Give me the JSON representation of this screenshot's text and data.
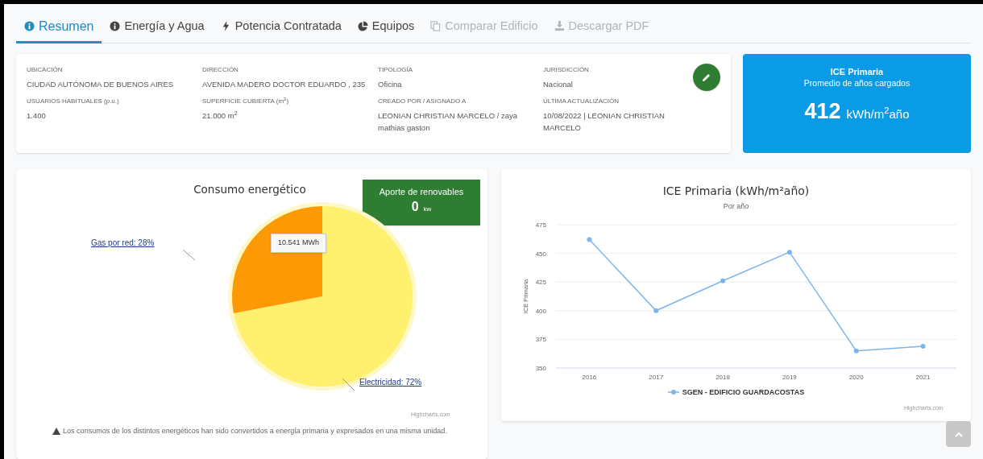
{
  "tabs": [
    {
      "label": "Resumen",
      "selected": true,
      "disabled": false
    },
    {
      "label": "Energía y Agua",
      "selected": false,
      "disabled": false
    },
    {
      "label": "Potencia Contratada",
      "selected": false,
      "disabled": false
    },
    {
      "label": "Equipos",
      "selected": false,
      "disabled": false
    },
    {
      "label": "Comparar Edificio",
      "selected": false,
      "disabled": true
    },
    {
      "label": "Descargar PDF",
      "selected": false,
      "disabled": true
    }
  ],
  "info_fields": [
    {
      "label": "UBICACIÓN",
      "value": "CIUDAD AUTÓNOMA DE BUENOS AIRES"
    },
    {
      "label": "DIRECCIÓN",
      "value": "AVENIDA MADERO DOCTOR EDUARDO , 235"
    },
    {
      "label": "TIPOLOGÍA",
      "value": "Oficina"
    },
    {
      "label": "JURISDICCIÓN",
      "value": "Nacional"
    },
    {
      "label": "USUARIOS HABITUALES (p.u.)",
      "value": "1.400"
    },
    {
      "label": "SUPERFICIE CUBIERTA (m$^{2}$)",
      "value": "21.000 m$^{2}$"
    },
    {
      "label": "CREADO POR / ASIGNADO A",
      "value": "LEONIAN CHRISTIAN MARCELO / zaya mathias gaston"
    },
    {
      "label": "ÚLTIMA ACTUALIZACIÓN",
      "value": "10/08/2022 | LEONIAN CHRISTIAN MARCELO"
    }
  ],
  "ice_card": {
    "title": "ICE Primaria",
    "subtitle": "Promedio de años cargados",
    "value": "412",
    "unit": "kWh/m$^{2}$año"
  },
  "consumption_panel": {
    "title": "Consumo energético",
    "renewables": {
      "label": "Aporte de renovables",
      "value": "0",
      "unit": "kw"
    },
    "tooltip": "10.541 MWh",
    "credits": "Highcharts.com",
    "note": "Los consumos de los distintos energéticos han sido convertidos a energía primaria y expresados en una misma unidad.",
    "chart_data": {
      "type": "pie",
      "values": [
        72,
        28
      ],
      "value_labels": [
        "Electricidad: 72%",
        "Gas por red: 28%"
      ]
    }
  },
  "ice_panel": {
    "title": "ICE Primaria (kWh/m²año)",
    "subtitle": "Por año",
    "credits": "Highcharts.com",
    "chart_data": {
      "type": "line",
      "grid": true,
      "ylabel": "ICE Primaria",
      "categories": [
        "2016",
        "2017",
        "2018",
        "2019",
        "2020",
        "2021"
      ],
      "ylim": [
        350,
        475
      ],
      "yticks": [
        350,
        375,
        400,
        425,
        450,
        475
      ],
      "series": [
        {
          "name": "SGEN - EDIFICIO GUARDACOSTAS",
          "color": "#7cb5ec",
          "marker": true,
          "values": [
            462,
            400,
            426,
            451,
            365,
            369
          ]
        }
      ]
    }
  }
}
